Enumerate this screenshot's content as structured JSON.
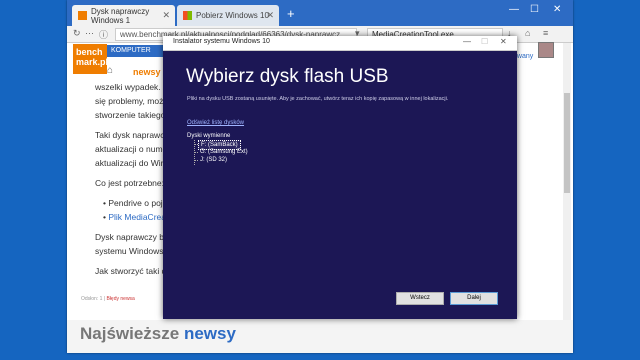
{
  "browser": {
    "tabs": [
      {
        "label": "Dysk naprawczy Windows 1",
        "active": true
      },
      {
        "label": "Pobierz Windows 10",
        "active": false
      }
    ],
    "url": "www.benchmark.pl/aktualnosci/podglad/66363/dysk-naprawcz",
    "search_value": "MediaCreationTool.exe"
  },
  "site": {
    "logo_line1": "bench",
    "logo_line2": "mark.pl",
    "nav_item": "KOMPUTER",
    "tagline": "newsy",
    "sidebar_link": "owany"
  },
  "article": {
    "lines": [
      "wszelki wypadek. S",
      "się problemy, może",
      "stworzenie takiego"
    ],
    "p2": [
      "Taki dysk naprawc",
      "aktualizacji o numer",
      "aktualizacji do Wind"
    ],
    "p3": "Co jest potrzebne:",
    "bullets": [
      "Pendrive o poje",
      "Plik MediaCrea"
    ],
    "p4": [
      "Dysk naprawczy bę",
      "systemu Windows 1"
    ],
    "p5": "Jak stworzyć taki dy",
    "meta_label": "Odsłon: 1",
    "meta_link": "Błędy newsa"
  },
  "footer": {
    "title_a": "Najświeższe",
    "title_b": "newsy"
  },
  "dialog": {
    "title": "Instalator systemu Windows 10",
    "heading": "Wybierz dysk flash USB",
    "subtext": "Pliki na dysku USB zostaną usunięte. Aby je zachować, utwórz teraz ich kopię zapasową w innej lokalizacji.",
    "refresh_link": "Odśwież listę dysków",
    "drives_label": "Dyski wymienne",
    "drives": [
      "F: (SamBack)",
      "G: (Samsung Ext)",
      "J: (SD 32)"
    ],
    "back_label": "Wstecz",
    "next_label": "Dalej"
  },
  "colors": {
    "dialog_bg": "#1c1755",
    "accent_blue": "#2d6bc4",
    "brand_orange": "#ef7d00"
  }
}
